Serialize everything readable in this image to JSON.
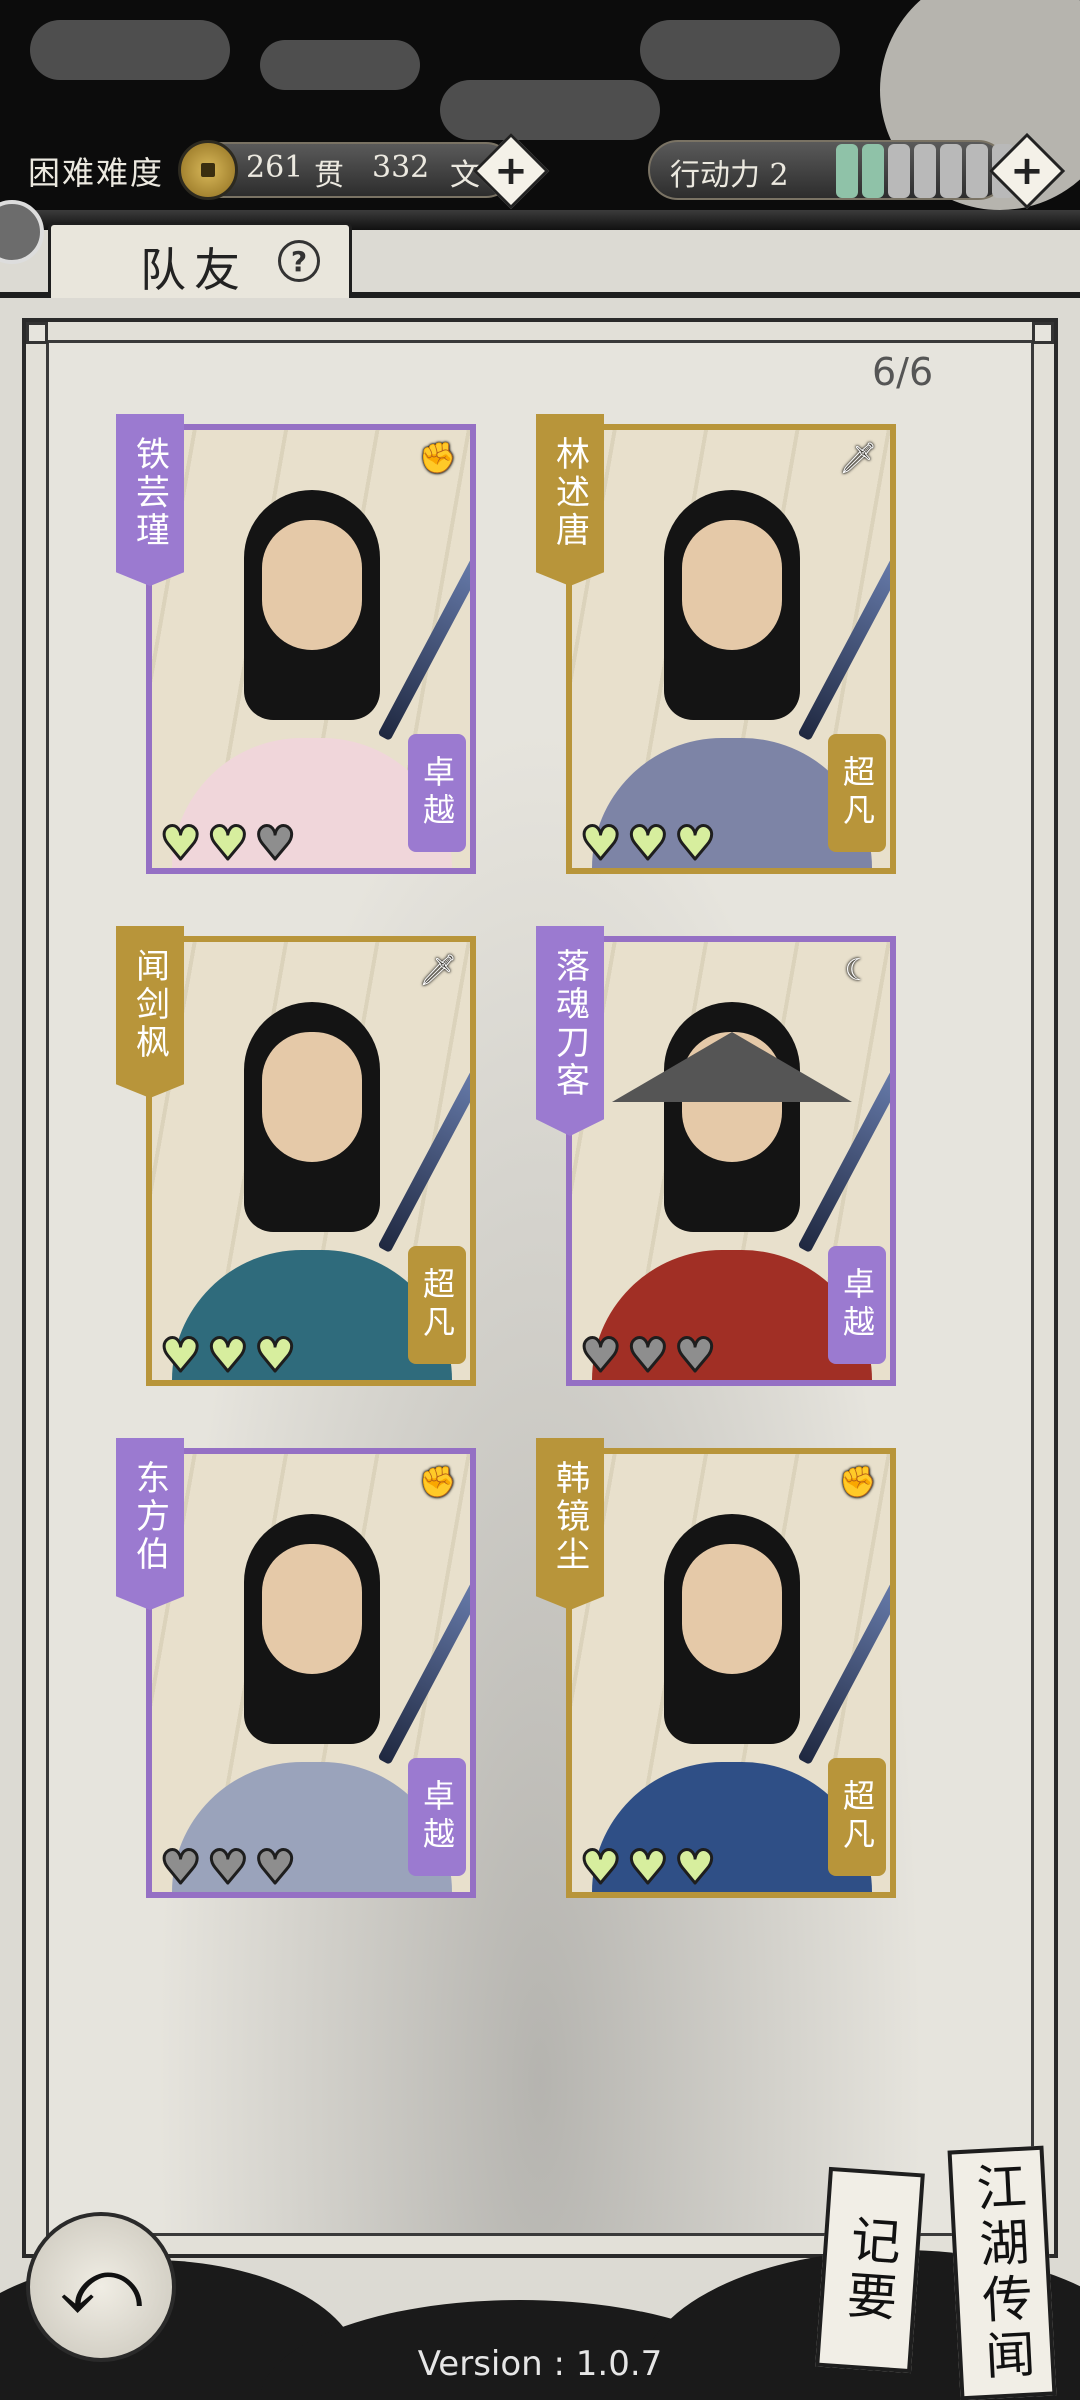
{
  "header": {
    "difficulty": "困难难度",
    "money_guan_value": "261",
    "money_guan_unit": "贯",
    "money_wen_value": "332",
    "money_wen_unit": "文",
    "plus_symbol": "+",
    "action_points_label": "行动力 2",
    "action_points_current": 2,
    "action_points_max": 7,
    "ap_filled_color": "#8fc2a8",
    "ap_empty_color": "#b9b9b9"
  },
  "tab": {
    "title": "队友",
    "help_symbol": "?"
  },
  "roster": {
    "count": "6/6"
  },
  "cards": [
    {
      "name": "铁芸瑾",
      "rank": "卓越",
      "rarity": "purple",
      "weapon": "fist-icon",
      "weapon_glyph": "✊",
      "hearts": [
        true,
        true,
        false
      ],
      "robe": "#f0d6da"
    },
    {
      "name": "林述唐",
      "rank": "超凡",
      "rarity": "gold",
      "weapon": "sword-icon",
      "weapon_glyph": "🗡",
      "hearts": [
        true,
        true,
        true
      ],
      "robe": "#7d84a6"
    },
    {
      "name": "闻剑枫",
      "rank": "超凡",
      "rarity": "gold",
      "weapon": "sword-icon",
      "weapon_glyph": "🗡",
      "hearts": [
        true,
        true,
        true
      ],
      "robe": "#2f6b7c"
    },
    {
      "name": "落魂刀客",
      "rank": "卓越",
      "rarity": "purple",
      "weapon": "blade-icon",
      "weapon_glyph": "☾",
      "hearts": [
        false,
        false,
        false
      ],
      "robe": "#a12f25"
    },
    {
      "name": "东方伯",
      "rank": "卓越",
      "rarity": "purple",
      "weapon": "fist-icon",
      "weapon_glyph": "✊",
      "hearts": [
        false,
        false,
        false
      ],
      "robe": "#9aa3bb"
    },
    {
      "name": "韩镜尘",
      "rank": "超凡",
      "rarity": "gold",
      "weapon": "fist-icon",
      "weapon_glyph": "✊",
      "hearts": [
        true,
        true,
        true
      ],
      "robe": "#2f4f86"
    }
  ],
  "heart_glyph": "♥",
  "footer": {
    "back_symbol": "⤺",
    "notes_label": "记要",
    "rumors_label": "江湖传闻",
    "version": "Version : 1.0.7"
  }
}
